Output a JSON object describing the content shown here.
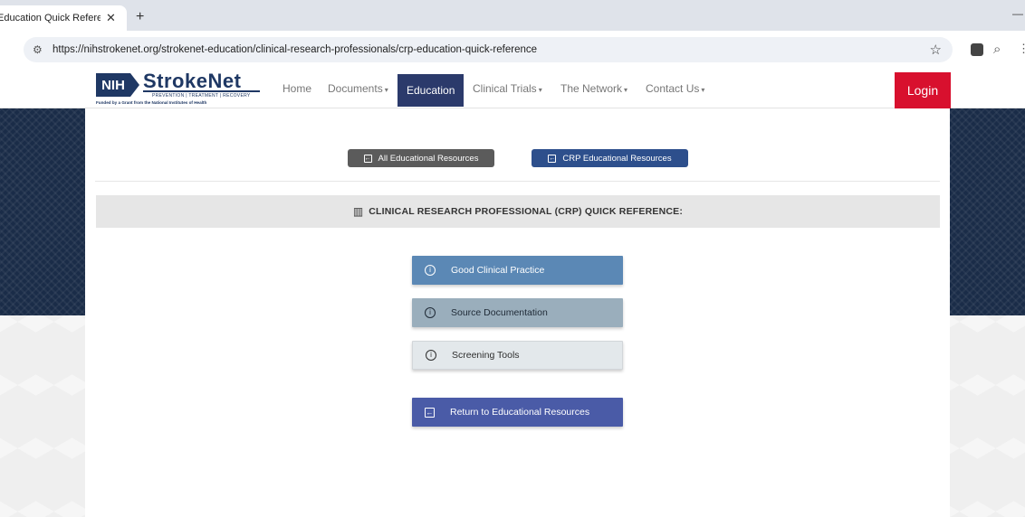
{
  "browser": {
    "tab_title": "Education Quick Reference",
    "tab_close": "✕",
    "new_tab": "+",
    "url": "https://nihstrokenet.org/strokenet-education/clinical-research-professionals/crp-education-quick-reference",
    "site_info_icon": "⚙",
    "star_icon": "☆"
  },
  "logo": {
    "nih": "NIH",
    "name": "StrokeNet",
    "tagline": "PREVENTION | TREATMENT | RECOVERY",
    "funded": "Funded by a Grant from the National Institutes of Health"
  },
  "nav": {
    "home": "Home",
    "documents": "Documents",
    "education": "Education",
    "clinical_trials": "Clinical Trials",
    "network": "The Network",
    "contact": "Contact Us",
    "caret": "▾",
    "login": "Login"
  },
  "resources": {
    "all": "All Educational Resources",
    "crp": "CRP Educational Resources"
  },
  "reference": {
    "title": "CLINICAL RESEARCH PROFESSIONAL (CRP)  QUICK REFERENCE:"
  },
  "topics": {
    "gcp": "Good Clinical Practice",
    "source": "Source Documentation",
    "screening": "Screening Tools",
    "return": "Return to Educational Resources"
  },
  "colors": {
    "brand_navy": "#1f3864",
    "nav_active": "#2b3a6b",
    "login_red": "#d8102e",
    "gcp_blue": "#5b88b5",
    "return_blue": "#4a5ba7"
  }
}
